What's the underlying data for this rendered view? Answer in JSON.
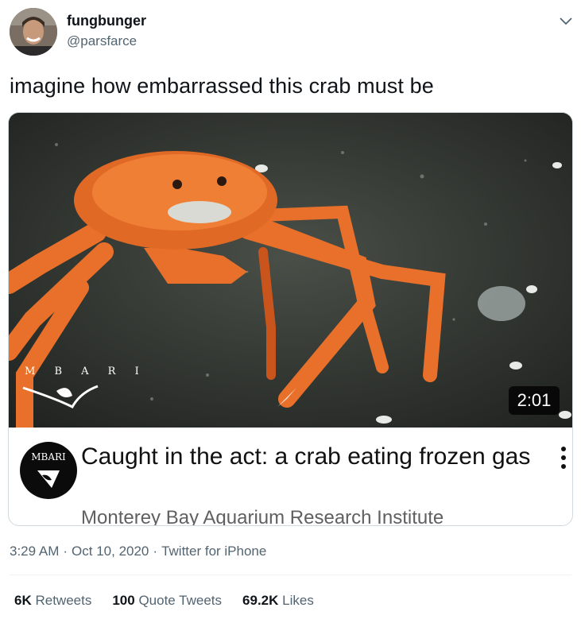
{
  "author": {
    "display_name": "fungbunger",
    "handle": "@parsfarce",
    "avatar_icon": "profile-photo"
  },
  "tweet": {
    "text": "imagine how embarrassed this crab must be"
  },
  "card": {
    "video": {
      "duration": "2:01",
      "watermark": "M B A R I"
    },
    "channel_logo_text": "MBARI",
    "title": "Caught in the act: a crab eating frozen gas",
    "channel": "Monterey Bay Aquarium Research Institute"
  },
  "meta": {
    "time": "3:29 AM",
    "date": "Oct 10, 2020",
    "source": "Twitter for iPhone",
    "separator": "·"
  },
  "stats": {
    "retweets_count": "6K",
    "retweets_label": "Retweets",
    "quotes_count": "100",
    "quotes_label": "Quote Tweets",
    "likes_count": "69.2K",
    "likes_label": "Likes"
  },
  "colors": {
    "text_primary": "#0f1419",
    "text_secondary": "#536471",
    "border": "#cfd9de",
    "crab_orange": "#e8702a"
  }
}
